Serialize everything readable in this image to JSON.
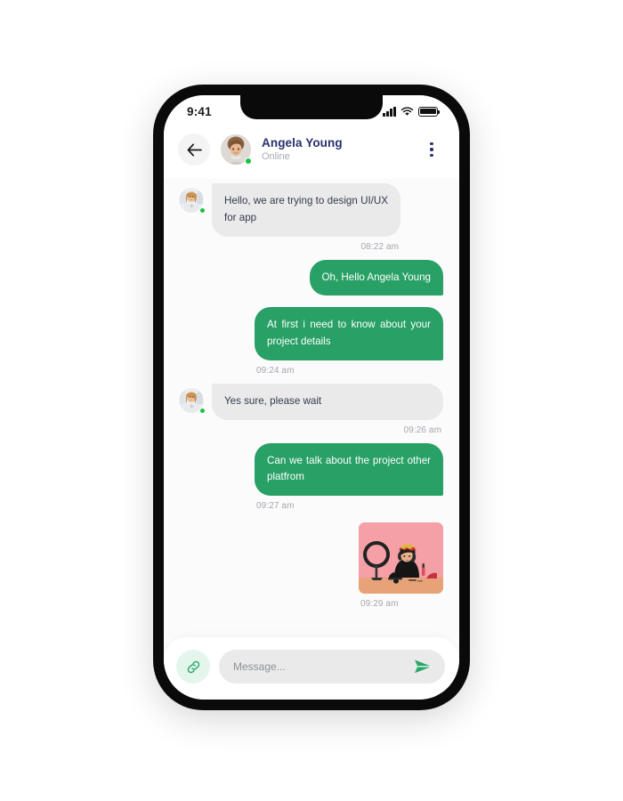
{
  "status_bar": {
    "time": "9:41",
    "signal_icon": "cellular-signal-icon",
    "wifi_icon": "wifi-icon",
    "battery_icon": "battery-full-icon"
  },
  "header": {
    "back_icon": "back-arrow-icon",
    "avatar_icon": "contact-avatar",
    "name": "Angela Young",
    "status": "Online",
    "menu_icon": "more-options-icon"
  },
  "conversation": [
    {
      "id": "msg-1",
      "direction": "in",
      "text": "Hello, we are trying to design UI/UX for app",
      "time": "08:22 am",
      "time_align": "right",
      "avatar": true
    },
    {
      "id": "msg-2",
      "direction": "out",
      "text": "Oh, Hello Angela Young",
      "time": "",
      "time_align": "none",
      "avatar": false
    },
    {
      "id": "msg-3",
      "direction": "out",
      "text": "At first i need to know about your project details",
      "time": "09:24 am",
      "time_align": "left",
      "avatar": false
    },
    {
      "id": "msg-4",
      "direction": "in",
      "text": "Yes sure, please wait",
      "time": "09:26 am",
      "time_align": "right",
      "avatar": true
    },
    {
      "id": "msg-5",
      "direction": "out",
      "text": "Can we talk about the project other platfrom",
      "time": "09:27 am",
      "time_align": "left",
      "avatar": false
    },
    {
      "id": "msg-6",
      "direction": "out",
      "type": "image",
      "text": "",
      "time": "09:29 am",
      "time_align": "left",
      "avatar": false,
      "image_alt": "photo-woman-with-ring-light"
    }
  ],
  "composer": {
    "attach_icon": "link-attachment-icon",
    "input_value": "",
    "input_placeholder": "Message...",
    "send_icon": "send-paper-plane-icon"
  },
  "colors": {
    "accent_green": "#28a066",
    "bubble_in": "#eaeaea",
    "text_dark_navy": "#27306b",
    "timestamp_grey": "#a3a7ae",
    "online_dot": "#19c23c",
    "photo_background": "#f4a0a6"
  }
}
